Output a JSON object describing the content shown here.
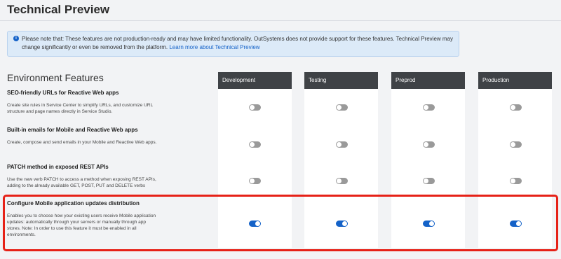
{
  "page": {
    "title": "Technical Preview"
  },
  "notice": {
    "text": "Please note that: These features are not production-ready and may have limited functionality. OutSystems does not provide support for these features. Technical Preview may change significantly or even be removed from the platform. ",
    "link": "Learn more about Technical Preview"
  },
  "section": {
    "title": "Environment Features"
  },
  "environments": [
    "Development",
    "Testing",
    "Preprod",
    "Production"
  ],
  "features": [
    {
      "name": "SEO-friendly URLs for Reactive Web apps",
      "description": "Create site rules in Service Center to simplify URLs, and customize URL structure and page names directly in Service Studio.",
      "toggles": [
        false,
        false,
        false,
        false
      ]
    },
    {
      "name": "Built-in emails for Mobile and Reactive Web apps",
      "description": "Create, compose and send emails in your Mobile and Reactive Web apps.",
      "toggles": [
        false,
        false,
        false,
        false
      ]
    },
    {
      "name": "PATCH method in exposed REST APIs",
      "description": "Use the new verb PATCH to access a method when exposing REST APIs, adding to the already available GET, POST, PUT and DELETE verbs",
      "toggles": [
        false,
        false,
        false,
        false
      ]
    },
    {
      "name": "Configure Mobile application updates distribution",
      "description": "Enables you to choose how your existing users receive Mobile application updates: automatically through your servers or manually through app stores. Note: In order to use this feature it must be enabled in all environments.",
      "toggles": [
        true,
        true,
        true,
        true
      ]
    }
  ],
  "colors": {
    "toggle_on": "#1462c8",
    "toggle_off": "#9a9a9a",
    "highlight": "#e62117",
    "column_header": "#3f4246"
  }
}
